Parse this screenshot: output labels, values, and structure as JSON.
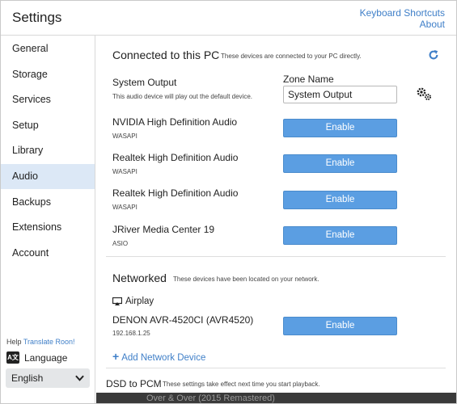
{
  "window": {
    "title": "Settings",
    "keyboard_shortcuts": "Keyboard Shortcuts",
    "about": "About"
  },
  "sidebar": {
    "items": [
      {
        "label": "General"
      },
      {
        "label": "Storage"
      },
      {
        "label": "Services"
      },
      {
        "label": "Setup"
      },
      {
        "label": "Library"
      },
      {
        "label": "Audio",
        "active": true
      },
      {
        "label": "Backups"
      },
      {
        "label": "Extensions"
      },
      {
        "label": "Account"
      }
    ],
    "help_text": "Help",
    "translate_link": "Translate Roon!",
    "language_label": "Language",
    "language_icon_text": "A文",
    "language_value": "English"
  },
  "connected": {
    "title": "Connected to this PC",
    "description": "These devices are connected to your PC directly.",
    "refresh_icon": "refresh-icon",
    "system_output": {
      "name": "System Output",
      "description": "This audio device will play out the default device.",
      "zone_label": "Zone Name",
      "zone_value": "System Output",
      "settings_icon": "gears-icon"
    },
    "devices": [
      {
        "name": "NVIDIA High Definition Audio",
        "sub": "WASAPI",
        "button": "Enable"
      },
      {
        "name": "Realtek High Definition Audio",
        "sub": "WASAPI",
        "button": "Enable"
      },
      {
        "name": "Realtek High Definition Audio",
        "sub": "WASAPI",
        "button": "Enable"
      },
      {
        "name": "JRiver Media Center 19",
        "sub": "ASIO",
        "button": "Enable"
      }
    ]
  },
  "networked": {
    "title": "Networked",
    "description": "These devices have been located on your network.",
    "group_label": "Airplay",
    "devices": [
      {
        "name": "DENON AVR-4520CI (AVR4520)",
        "sub": "192.168.1.25",
        "button": "Enable"
      }
    ],
    "add_device": "Add Network Device"
  },
  "dsd": {
    "title": "DSD to PCM",
    "description": "These settings take effect next time you start playback."
  },
  "background_text": "Over & Over (2015 Remastered)",
  "colors": {
    "accent": "#5b9ee2",
    "link": "#3f7fc8",
    "active_sidebar": "#dce8f6"
  }
}
